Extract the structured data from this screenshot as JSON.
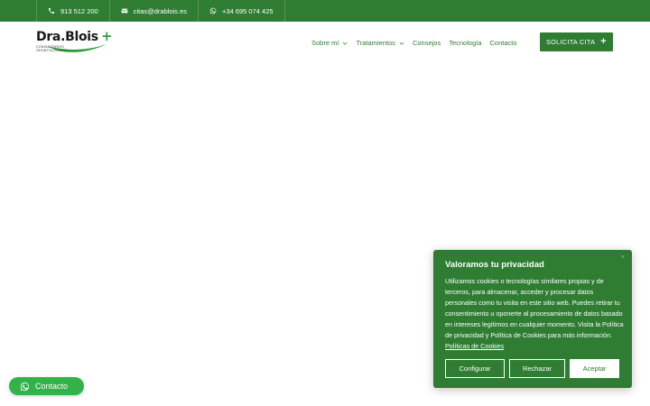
{
  "topbar": {
    "phone": "913 512 200",
    "email": "citas@drablois.es",
    "whatsapp": "+34 695 074 425"
  },
  "header": {
    "logo_name": "Dra.Blois",
    "logo_plus": "+",
    "logo_subtitle_1": "CONSULTORIOS",
    "logo_subtitle_2": "ODONTOLÓGICOS",
    "nav": [
      {
        "label": "Sobre mí"
      },
      {
        "label": "Tratamientos"
      },
      {
        "label": "Consejos"
      },
      {
        "label": "Tecnología"
      },
      {
        "label": "Contacto"
      }
    ],
    "cta_label": "SOLICITA CITA",
    "cta_icon": "+"
  },
  "cookie_panel": {
    "title": "Valoramos tu privacidad",
    "close_icon": "×",
    "body": "Utilizamos cookies o tecnologías similares propias y de terceros, para almacenar, acceder y procesar datos personales como tu visita en este sitio web. Puedes retirar tu consentimiento u oponerte al procesamiento de datos basado en intereses legítimos en cualquier momento. Visita la Política de privacidad y Política de Cookies para más información.",
    "link": "Políticas de Cookies",
    "buttons": {
      "configure": "Configurar",
      "reject": "Rechazar",
      "accept": "Aceptar"
    }
  },
  "floating_button": {
    "label": "Contacto"
  },
  "colors": {
    "brand_green": "#2e7d32",
    "fab_green": "#34b24a",
    "white": "#ffffff"
  }
}
